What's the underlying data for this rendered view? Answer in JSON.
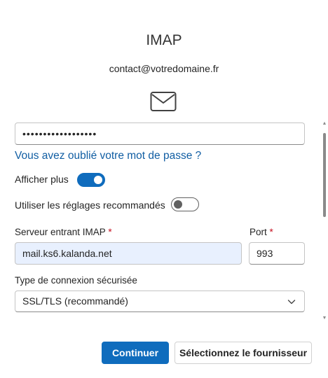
{
  "header": {
    "title": "IMAP",
    "email": "contact@votredomaine.fr",
    "icon": "envelope-icon"
  },
  "password": {
    "masked_value": "••••••••••••••••••"
  },
  "links": {
    "forgot_password": "Vous avez oublié votre mot de passe ?"
  },
  "toggles": {
    "show_more": {
      "label": "Afficher plus",
      "state": "on"
    },
    "recommended_settings": {
      "label": "Utiliser les réglages recommandés",
      "state": "off"
    }
  },
  "incoming_server": {
    "label": "Serveur entrant IMAP",
    "required_mark": "*",
    "value": "mail.ks6.kalanda.net"
  },
  "port": {
    "label": "Port",
    "required_mark": "*",
    "value": "993"
  },
  "security": {
    "label": "Type de connexion sécurisée",
    "selected": "SSL/TLS (recommandé)"
  },
  "buttons": {
    "continue": "Continuer",
    "select_provider": "Sélectionnez le fournisseur"
  },
  "colors": {
    "accent": "#0f6cbd",
    "link": "#115ea3",
    "autofill_bg": "#e8f0fe",
    "required": "#c50f1f"
  }
}
